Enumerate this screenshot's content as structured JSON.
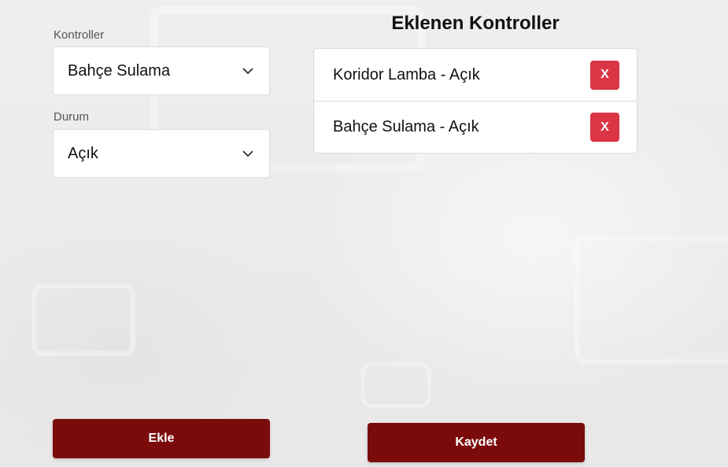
{
  "form": {
    "controller_label": "Kontroller",
    "controller_value": "Bahçe Sulama",
    "status_label": "Durum",
    "status_value": "Açık"
  },
  "added": {
    "title": "Eklenen Kontroller",
    "items": [
      {
        "text": "Koridor Lamba - Açık",
        "remove_label": "X"
      },
      {
        "text": "Bahçe Sulama - Açık",
        "remove_label": "X"
      }
    ]
  },
  "actions": {
    "add_label": "Ekle",
    "save_label": "Kaydet"
  },
  "colors": {
    "primary": "#7b0b0b",
    "danger": "#dc3545"
  },
  "icons": {
    "dropdown": "chevron-down-icon"
  }
}
